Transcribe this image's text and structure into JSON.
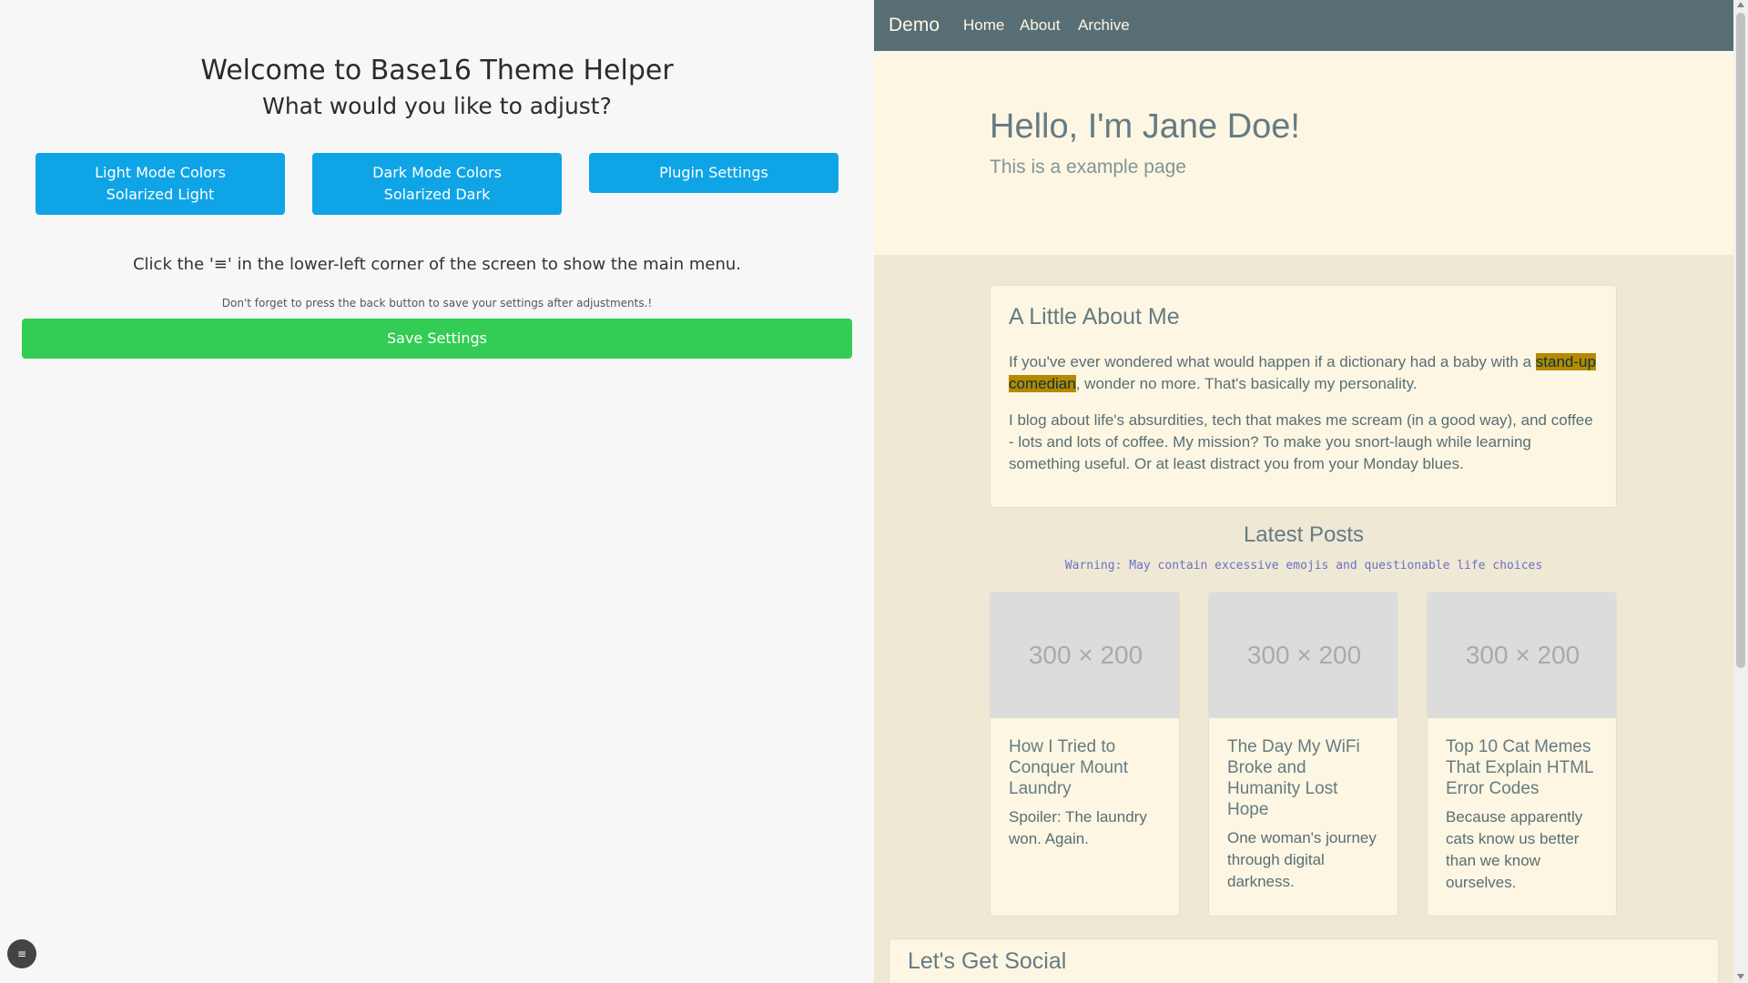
{
  "helper": {
    "title": "Welcome to Base16 Theme Helper",
    "subtitle": "What would you like to adjust?",
    "buttons": {
      "light": {
        "line1": "Light Mode Colors",
        "line2": "Solarized Light"
      },
      "dark": {
        "line1": "Dark Mode Colors",
        "line2": "Solarized Dark"
      },
      "plugin": {
        "label": "Plugin Settings"
      }
    },
    "hint": "Click the '≡' in the lower-left corner of the screen to show the main menu.",
    "note": "Don't forget to press the back button to save your settings after adjustments.!",
    "save_label": "Save Settings",
    "menu_icon": "≡"
  },
  "preview": {
    "navbar": {
      "brand": "Demo",
      "links": [
        "Home",
        "About",
        "Archive"
      ]
    },
    "hero": {
      "title": "Hello, I'm Jane Doe!",
      "subtitle": "This is a example page"
    },
    "about": {
      "title": "A Little About Me",
      "p1_before": "If you've ever wondered what would happen if a dictionary had a baby with a ",
      "p1_highlight": "stand-up comedian",
      "p1_after": ", wonder no more. That's basically my personality.",
      "p2": "I blog about life's absurdities, tech that makes me scream (in a good way), and coffee - lots and lots of coffee. My mission? To make you snort-laugh while learning something useful. Or at least distract you from your Monday blues."
    },
    "posts": {
      "title": "Latest Posts",
      "warning": "Warning: May contain excessive emojis and questionable life choices",
      "items": [
        {
          "image_label": "300 × 200",
          "title": "How I Tried to Conquer Mount Laundry",
          "desc": "Spoiler: The laundry won. Again."
        },
        {
          "image_label": "300 × 200",
          "title": "The Day My WiFi Broke and Humanity Lost Hope",
          "desc": "One woman's journey through digital darkness."
        },
        {
          "image_label": "300 × 200",
          "title": "Top 10 Cat Memes That Explain HTML Error Codes",
          "desc": "Because apparently cats know us better than we know ourselves."
        }
      ]
    },
    "social": {
      "title": "Let's Get Social"
    }
  },
  "colors": {
    "helper_button": "#0fa4e6",
    "save_button": "#33cc55",
    "navbar": "#586e75",
    "preview_background": "#eee8d5",
    "card_background": "#fdf6e3",
    "highlight": "#b58900",
    "warning_text": "#6c71c4"
  }
}
